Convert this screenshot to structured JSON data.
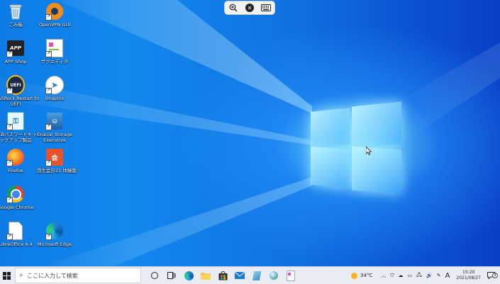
{
  "toolbar": {
    "zoom_icon": "magnifier-plus-icon",
    "tools_icon": "wrench-cross-icon",
    "keyboard_icon": "keyboard-icon"
  },
  "desktop_icons": [
    {
      "label": "ごみ箱",
      "icon": "recycle-bin-icon"
    },
    {
      "label": "OpenVPN GUI",
      "icon": "openvpn-icon"
    },
    {
      "label": "APP Shop",
      "icon": "app-shop-icon"
    },
    {
      "label": "ザクエディタ",
      "icon": "text-editor-icon"
    },
    {
      "label": "ASRock Restart to",
      "label2": "UEFI",
      "icon": "uefi-icon"
    },
    {
      "label": "Unaplos",
      "icon": "unaplos-icon"
    },
    {
      "label": "CBパスワードキットバ",
      "label2": "ックアップ製品",
      "icon": "password-kit-icon"
    },
    {
      "label": "Crucial Storage",
      "label2": "Executive",
      "icon": "crucial-storage-icon"
    },
    {
      "label": "Firefox",
      "icon": "firefox-icon"
    },
    {
      "label": "弥生会計21 体験版",
      "icon": "yayoi-icon"
    },
    {
      "label": "Google Chrome",
      "icon": "chrome-icon"
    },
    {
      "label": "LibreOffice 6.4",
      "icon": "libreoffice-icon"
    },
    {
      "label": "Microsoft Edge",
      "icon": "edge-icon"
    }
  ],
  "taskbar": {
    "search_placeholder": "ここに入力して検索",
    "weather_temp": "34°C",
    "ime_mode": "A",
    "time": "15:20",
    "date": "2021/08/27",
    "notification_count": "3"
  },
  "colors": {
    "desktop_blue": "#0a4ad0",
    "taskbar_bg": "#e9edf3",
    "accent": "#0078d7"
  }
}
